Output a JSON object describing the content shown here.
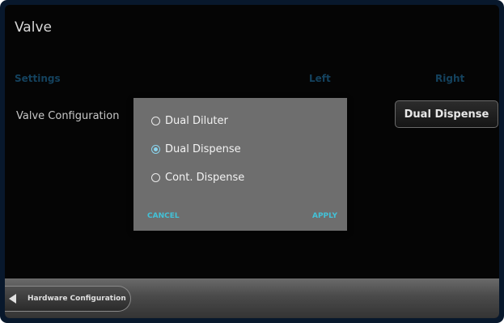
{
  "page": {
    "title": "Valve"
  },
  "table": {
    "headers": {
      "settings": "Settings",
      "left": "Left",
      "right": "Right"
    },
    "row": {
      "label": "Valve Configuration",
      "right_value": "Dual Dispense"
    }
  },
  "dialog": {
    "options": [
      {
        "label": "Dual Diluter",
        "selected": false
      },
      {
        "label": "Dual Dispense",
        "selected": true
      },
      {
        "label": "Cont. Dispense",
        "selected": false
      }
    ],
    "cancel_label": "CANCEL",
    "apply_label": "APPLY"
  },
  "footer": {
    "back_label": "Hardware Configuration",
    "back_icon": "arrow-left-icon"
  },
  "colors": {
    "accent": "#42c2d8",
    "header": "#14425e",
    "dialog_bg": "#6e6e6e"
  }
}
